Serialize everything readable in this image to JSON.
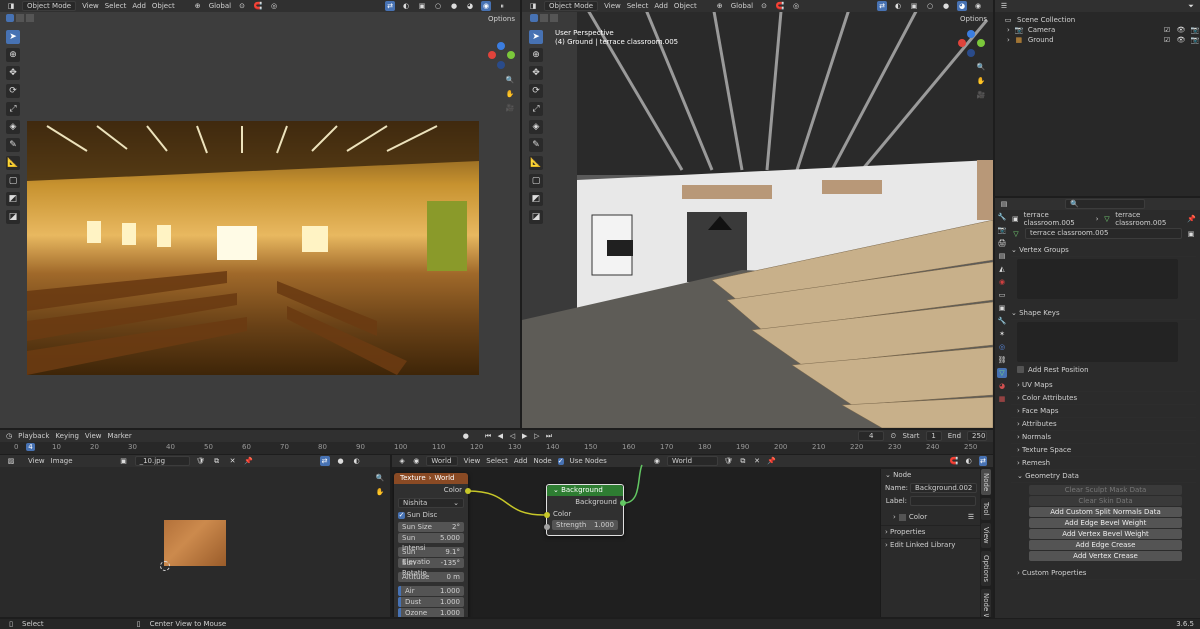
{
  "left_view": {
    "mode": "Object Mode",
    "menus": [
      "View",
      "Select",
      "Add",
      "Object"
    ],
    "transform": "Global",
    "options": "Options"
  },
  "right_view": {
    "mode": "Object Mode",
    "menus": [
      "View",
      "Select",
      "Add",
      "Object"
    ],
    "transform": "Global",
    "options": "Options",
    "info_line1": "User Perspective",
    "info_line2": "(4) Ground | terrace classroom.005"
  },
  "outliner": {
    "collection": "Scene Collection",
    "items": [
      "Camera",
      "Ground"
    ]
  },
  "timeline": {
    "menus": [
      "Playback",
      "Keying",
      "View",
      "Marker"
    ],
    "current_frame": "4",
    "start_label": "Start",
    "start": "1",
    "end_label": "End",
    "end": "250",
    "ticks": [
      "0",
      "10",
      "20",
      "30",
      "40",
      "50",
      "60",
      "70",
      "80",
      "90",
      "100",
      "110",
      "120",
      "130",
      "140",
      "150",
      "160",
      "170",
      "180",
      "190",
      "200",
      "210",
      "220",
      "230",
      "240",
      "250"
    ]
  },
  "image_editor": {
    "menus": [
      "View",
      "Image"
    ],
    "image_name": "_10.jpg"
  },
  "node_editor": {
    "world_label": "World",
    "menus": [
      "View",
      "Select",
      "Add",
      "Node"
    ],
    "use_nodes": "Use Nodes",
    "world_selector": "World",
    "breadcrumb_texture": "Texture",
    "breadcrumb_world": "World",
    "sky_node": {
      "color_out": "Color",
      "sky_type": "Nishita",
      "sun_disc": "Sun Disc",
      "fields": [
        {
          "label": "Sun Size",
          "value": "2°"
        },
        {
          "label": "Sun Intensi",
          "value": "5.000"
        },
        {
          "label": "Sun Elevatio",
          "value": "9.1°"
        },
        {
          "label": "Sun Rotatio",
          "value": "-135°"
        },
        {
          "label": "Altitude",
          "value": "0 m"
        },
        {
          "label": "Air",
          "value": "1.000"
        },
        {
          "label": "Dust",
          "value": "1.000"
        },
        {
          "label": "Ozone",
          "value": "1.000"
        }
      ]
    },
    "background_node": {
      "title": "Background",
      "out": "Background",
      "color_in": "Color",
      "strength_label": "Strength",
      "strength": "1.000"
    },
    "sidebar": {
      "section": "Node",
      "name_label": "Name:",
      "name_value": "Background.002",
      "label_label": "Label:",
      "color": "Color",
      "properties": "Properties",
      "edit_linked": "Edit Linked Library",
      "tabs": [
        "Node",
        "Tool",
        "View",
        "Options",
        "Node Wrangler"
      ]
    }
  },
  "properties": {
    "breadcrumb_obj": "terrace classroom.005",
    "breadcrumb_mesh": "terrace classroom.005",
    "mesh_name": "terrace classroom.005",
    "vertex_groups": "Vertex Groups",
    "shape_keys": "Shape Keys",
    "add_rest_position": "Add Rest Position",
    "panels": [
      "UV Maps",
      "Color Attributes",
      "Face Maps",
      "Attributes",
      "Normals",
      "Texture Space",
      "Remesh"
    ],
    "geometry_data": "Geometry Data",
    "geo_buttons_disabled": [
      "Clear Sculpt Mask Data",
      "Clear Skin Data"
    ],
    "geo_buttons": [
      "Add Custom Split Normals Data",
      "Add Edge Bevel Weight",
      "Add Vertex Bevel Weight",
      "Add Edge Crease",
      "Add Vertex Crease"
    ],
    "custom_properties": "Custom Properties"
  },
  "status_bar": {
    "select": "Select",
    "center": "Center View to Mouse",
    "version": "3.6.5"
  },
  "colors": {
    "accent": "#4772b3",
    "background_node_header": "#2e7d32",
    "texture_node_header": "#8a4a24",
    "socket_yellow": "#c7c729",
    "socket_green": "#63c763"
  }
}
